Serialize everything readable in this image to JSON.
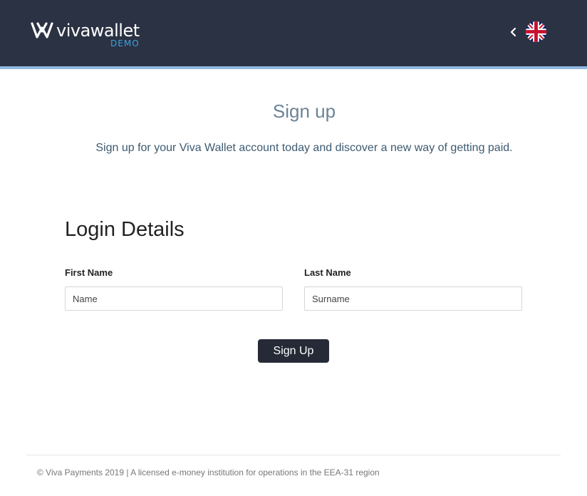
{
  "header": {
    "logo_text": "vivawallet",
    "logo_badge": "DEMO",
    "back_icon": "chevron-left-icon",
    "language_icon": "uk-flag-icon",
    "background_color": "#2b3244",
    "accent_color": "#3aa3dd"
  },
  "intro": {
    "title": "Sign up",
    "subtitle": "Sign up for your Viva Wallet account today and discover a new way of getting paid."
  },
  "form": {
    "section_title": "Login Details",
    "first_name": {
      "label": "First Name",
      "placeholder": "Name",
      "value": ""
    },
    "last_name": {
      "label": "Last Name",
      "placeholder": "Surname",
      "value": ""
    },
    "submit_label": "Sign Up",
    "button_color": "#252a36"
  },
  "footer": {
    "text": "© Viva Payments 2019 | A licensed e-money institution for operations in the EEA-31 region"
  }
}
